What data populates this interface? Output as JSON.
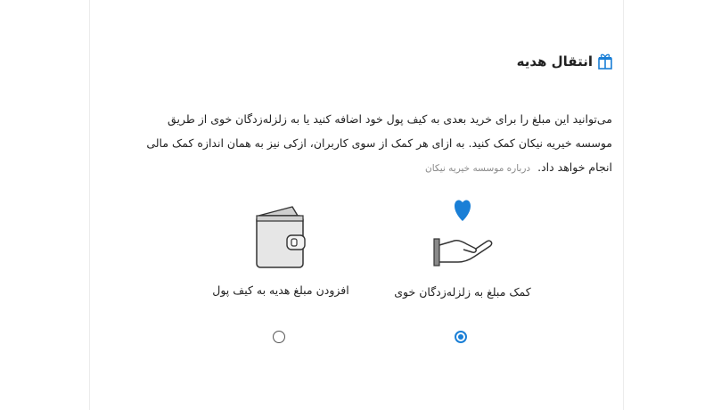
{
  "section": {
    "title": "انتقال هدیه",
    "description": "می‌توانید این مبلغ را برای خرید بعدی به کیف پول خود اضافه کنید یا به زلزله‌زدگان خوی از طریق موسسه خیریه نیکان کمک کنید. به ازای هر کمک از سوی کاربران، ازکی نیز به همان اندازه کمک مالی انجام خواهد داد.",
    "about_link": "درباره موسسه خیریه نیکان"
  },
  "options": {
    "donate": {
      "label": "کمک مبلغ به زلزله‌زدگان خوی",
      "selected": true,
      "icon": "heart-hand-icon"
    },
    "wallet": {
      "label": "افزودن مبلغ هدیه به کیف پول",
      "selected": false,
      "icon": "wallet-icon"
    }
  },
  "colors": {
    "accent": "#1a7fd6",
    "text": "#222222",
    "muted": "#8a8a8a"
  }
}
